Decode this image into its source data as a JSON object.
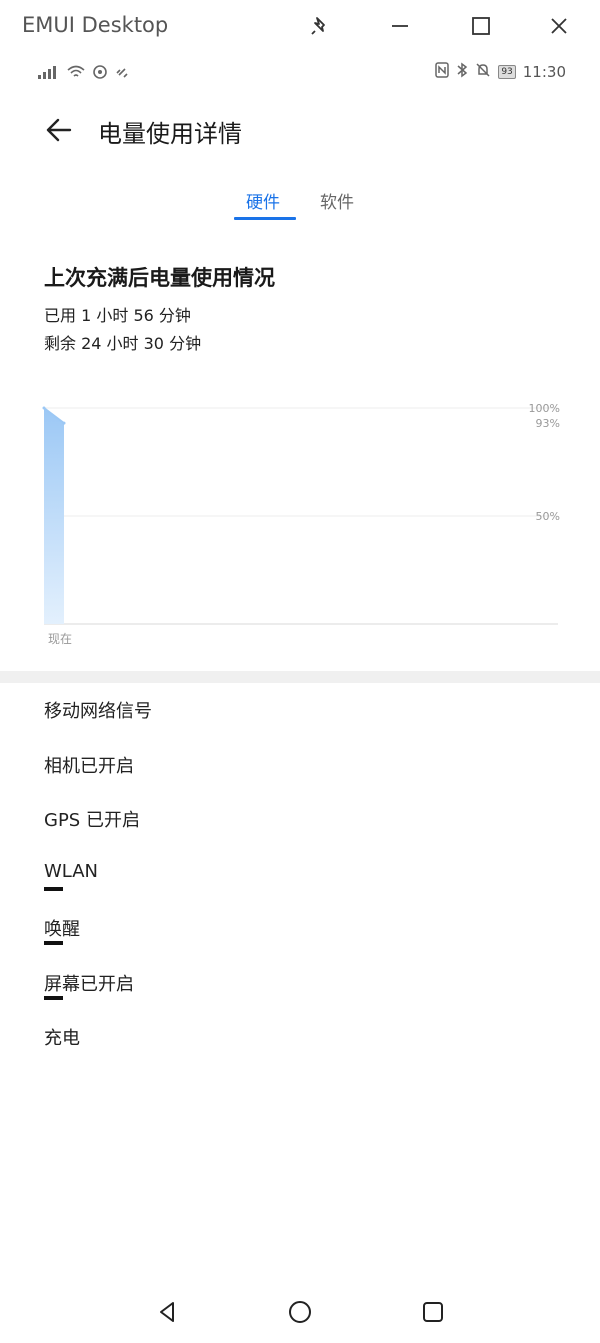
{
  "window": {
    "title": "EMUI Desktop",
    "controls": {
      "pin": "pin-icon",
      "minimize": "minimize-icon",
      "maximize": "maximize-icon",
      "close": "close-icon"
    }
  },
  "status_bar": {
    "left_icons": [
      "signal-icon",
      "wifi-icon",
      "hotspot-icon",
      "link-icon"
    ],
    "battery": "93",
    "time": "11:30"
  },
  "header": {
    "title": "电量使用详情"
  },
  "tabs": [
    {
      "label": "硬件",
      "active": true
    },
    {
      "label": "软件",
      "active": false
    }
  ],
  "summary": {
    "title": "上次充满后电量使用情况",
    "used": "已用 1 小时 56 分钟",
    "remaining": "剩余 24 小时 30 分钟"
  },
  "chart_data": {
    "type": "area",
    "title": "",
    "xlabel": "",
    "ylabel": "",
    "ylim": [
      0,
      100
    ],
    "y_tick_labels": [
      "100%",
      "93%",
      "50%"
    ],
    "x_tick_labels": [
      "现在"
    ],
    "series": [
      {
        "values": [
          100,
          93
        ]
      }
    ],
    "grid": true,
    "accent_color": "#9cc8f5"
  },
  "list": {
    "items": [
      {
        "label": "移动网络信号",
        "bar": false
      },
      {
        "label": "相机已开启",
        "bar": false
      },
      {
        "label": "GPS 已开启",
        "bar": false
      },
      {
        "label": "WLAN",
        "bar": true
      },
      {
        "label": "唤醒",
        "bar": true
      },
      {
        "label": "屏幕已开启",
        "bar": true
      },
      {
        "label": "充电",
        "bar": false
      }
    ]
  },
  "nav": {
    "back": "nav-back-icon",
    "home": "nav-home-icon",
    "recents": "nav-recents-icon"
  }
}
